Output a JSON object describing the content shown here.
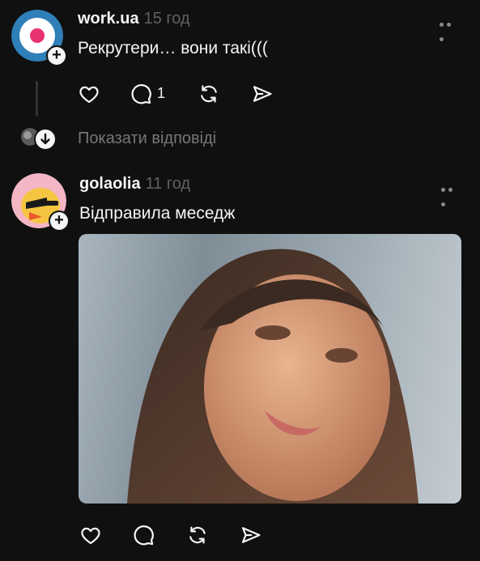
{
  "posts": [
    {
      "username": "work.ua",
      "time": "15 год",
      "text": "Рекрутери… вони такі(((",
      "actions": {
        "like": "like",
        "reply_count": "1",
        "repost": "repost",
        "share": "share"
      }
    },
    {
      "username": "golaolia",
      "time": "11 год",
      "text": "Відправила меседж",
      "image_alt": "photo",
      "actions": {
        "like": "like",
        "reply": "reply",
        "repost": "repost",
        "share": "share"
      }
    }
  ],
  "show_replies_label": "Показати відповіді",
  "colors": {
    "bg": "#101010",
    "text": "#f3f5f7",
    "muted": "#616161",
    "workua_pink": "#e8336f"
  },
  "icons": [
    "heart-icon",
    "comment-icon",
    "repost-icon",
    "send-icon",
    "more-icon",
    "plus-icon",
    "arrow-down-icon"
  ]
}
